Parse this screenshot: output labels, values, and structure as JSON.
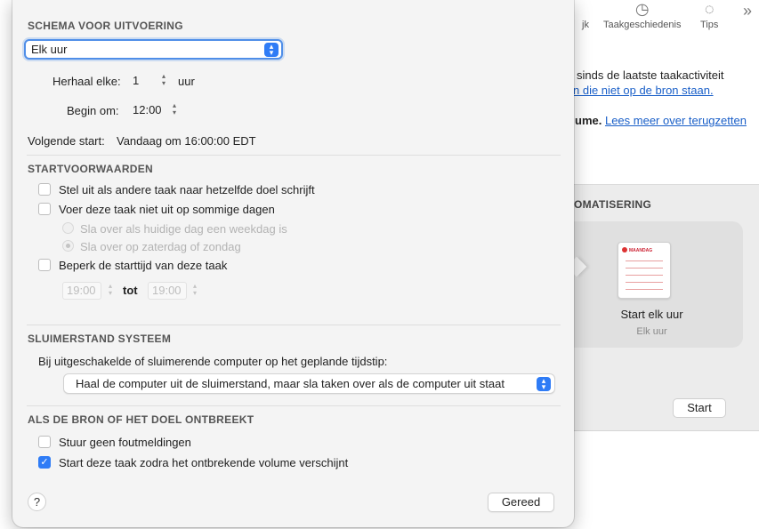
{
  "background": {
    "toolbar": {
      "items": [
        {
          "label": "jk",
          "icon": "info-icon"
        },
        {
          "label": "Taakgeschiedenis",
          "icon": "clock-icon"
        },
        {
          "label": "Tips",
          "icon": "lightbulb-icon"
        }
      ],
      "overflow_icon": "chevron-double-right-icon",
      "overflow_glyph": "»"
    },
    "text_line1": "sinds de laatste taakactiviteit",
    "link_line2": "n die niet op de bron staan.",
    "text_line3": "ume.",
    "link_line3": "Lees meer over terugzetten",
    "automation_heading": "OMATISERING",
    "automation_card": {
      "calendar_label": "MAANDAG",
      "title": "Start elk uur",
      "subtitle": "Elk uur"
    },
    "start_button": "Start"
  },
  "popover": {
    "schedule": {
      "title": "SCHEMA VOOR UITVOERING",
      "selected": "Elk uur",
      "repeat_label": "Herhaal elke:",
      "repeat_value": "1",
      "repeat_unit": "uur",
      "begin_label": "Begin om:",
      "begin_value": "12:00",
      "next_start_label": "Volgende start:",
      "next_start_value": "Vandaag om 16:00:00 EDT"
    },
    "conditions": {
      "title": "STARTVOORWAARDEN",
      "option1": "Stel uit als andere taak naar hetzelfde doel schrijft",
      "option2": "Voer deze taak niet uit op sommige dagen",
      "radio1": "Sla over als huidige dag een weekdag is",
      "radio2": "Sla over op zaterdag of zondag",
      "option3": "Beperk de starttijd van deze taak",
      "from_time": "19:00",
      "to_label": "tot",
      "to_time": "19:00"
    },
    "sleep": {
      "title": "SLUIMERSTAND SYSTEEM",
      "description": "Bij uitgeschakelde of sluimerende computer op het geplande tijdstip:",
      "selected": "Haal de computer uit de sluimerstand, maar sla taken over als de computer uit staat"
    },
    "missing": {
      "title": "ALS DE BRON OF HET DOEL ONTBREEKT",
      "option1": "Stuur geen foutmeldingen",
      "option1_checked": false,
      "option2": "Start deze taak zodra het ontbrekende volume verschijnt",
      "option2_checked": true
    },
    "help_label": "?",
    "done_button": "Gereed"
  },
  "colors": {
    "accent": "#2f7cf6",
    "link": "#1a5fc8",
    "popover_bg": "#f4f4f4"
  }
}
